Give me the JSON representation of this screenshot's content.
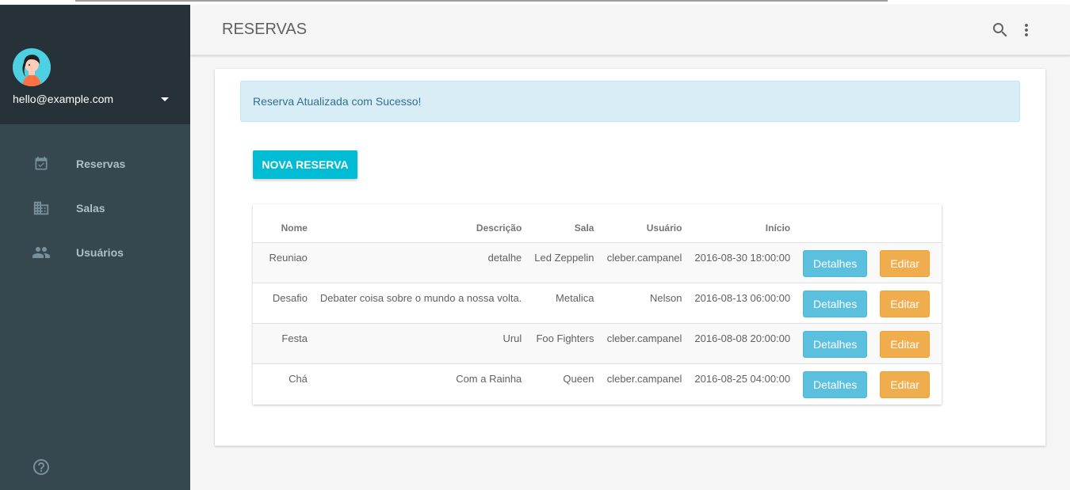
{
  "account": {
    "email": "hello@example.com"
  },
  "nav": {
    "items": [
      {
        "label": "Reservas",
        "icon": "calendar-check-icon"
      },
      {
        "label": "Salas",
        "icon": "building-icon"
      },
      {
        "label": "Usuários",
        "icon": "people-icon"
      }
    ]
  },
  "appbar": {
    "title": "RESERVAS"
  },
  "alert": {
    "message": "Reserva Atualizada com Sucesso!"
  },
  "actions": {
    "new_label": "NOVA RESERVA"
  },
  "table": {
    "headers": {
      "nome": "Nome",
      "descricao": "Descrição",
      "sala": "Sala",
      "usuario": "Usuário",
      "inicio": "Início"
    },
    "details_label": "Detalhes",
    "edit_label": "Editar",
    "rows": [
      {
        "nome": "Reuniao",
        "descricao": "detalhe",
        "sala": "Led Zeppelin",
        "usuario": "cleber.campanel",
        "inicio": "2016-08-30 18:00:00"
      },
      {
        "nome": "Desafio",
        "descricao": "Debater coisa sobre o mundo a nossa volta.",
        "sala": "Metalica",
        "usuario": "Nelson",
        "inicio": "2016-08-13 06:00:00"
      },
      {
        "nome": "Festa",
        "descricao": "Urul",
        "sala": "Foo Fighters",
        "usuario": "cleber.campanel",
        "inicio": "2016-08-08 20:00:00"
      },
      {
        "nome": "Chá",
        "descricao": "Com a Rainha",
        "sala": "Queen",
        "usuario": "cleber.campanel",
        "inicio": "2016-08-25 04:00:00"
      }
    ]
  },
  "colors": {
    "sidebar": "#37474f",
    "sidebar_header": "#263238",
    "primary": "#00bcd4",
    "info": "#5bc0de",
    "warning": "#f0ad4e",
    "alert_bg": "#d9edf7"
  }
}
